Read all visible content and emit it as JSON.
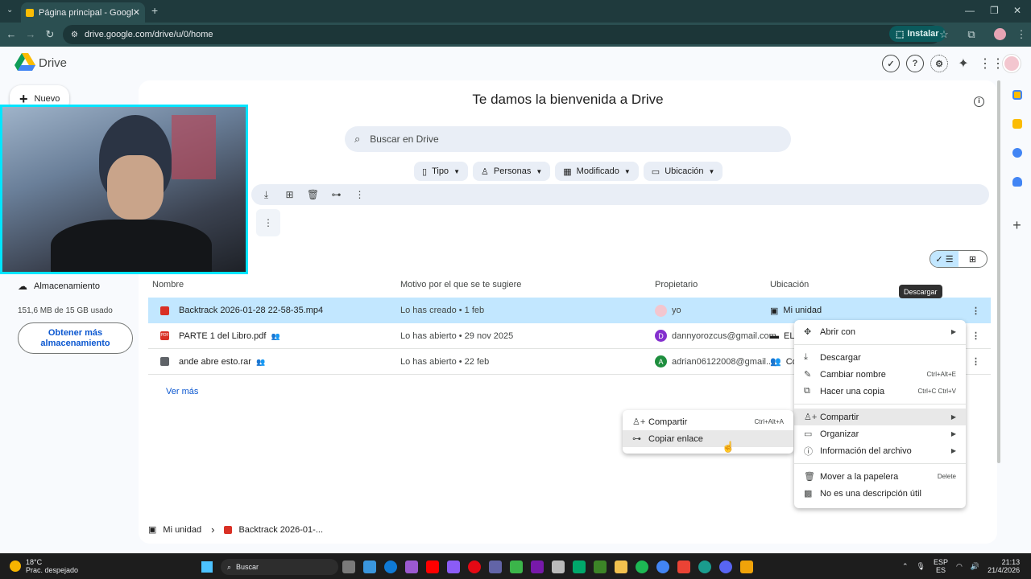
{
  "browser": {
    "tab_title": "Página principal - Google Drive",
    "url": "drive.google.com/drive/u/0/home",
    "install_label": "Instalar"
  },
  "app": {
    "brand": "Drive",
    "new_label": "Nuevo"
  },
  "sidebar": {
    "storage_label": "Almacenamiento",
    "storage_used": "151,6 MB de 15 GB usado",
    "get_more": "Obtener más almacenamiento"
  },
  "main": {
    "welcome": "Te damos la bienvenida a Drive",
    "search_placeholder": "Buscar en Drive",
    "filters": [
      "Tipo",
      "Personas",
      "Modificado",
      "Ubicación"
    ],
    "columns": [
      "Nombre",
      "Motivo por el que se te sugiere",
      "Propietario",
      "Ubicación"
    ],
    "rows": [
      {
        "name": "Backtrack 2026-01-28 22-58-35.mp4",
        "reason": "Lo has creado • 1 feb",
        "owner": "yo",
        "location": "Mi unidad",
        "icon": "video-icon",
        "icon_color": "#d93025"
      },
      {
        "name": "PARTE 1 del Libro.pdf",
        "reason": "Lo has abierto • 29 nov 2025",
        "owner": "dannyorozcus@gmail.com",
        "owner_initial": "D",
        "owner_color": "#8430ce",
        "location": "EL",
        "icon": "pdf-icon",
        "icon_color": "#d93025"
      },
      {
        "name": "ande abre esto.rar",
        "reason": "Lo has abierto • 22 feb",
        "owner": "adrian06122008@gmail....",
        "owner_initial": "A",
        "owner_color": "#1e8e3e",
        "location": "Co",
        "icon": "archive-icon",
        "icon_color": "#5f6368"
      }
    ],
    "see_more": "Ver más",
    "tooltip": "Descargar"
  },
  "context_menu": {
    "open_with": "Abrir con",
    "download": "Descargar",
    "rename": "Cambiar nombre",
    "rename_shortcut": "Ctrl+Alt+E",
    "copy": "Hacer una copia",
    "copy_shortcut": "Ctrl+C Ctrl+V",
    "share": "Compartir",
    "organize": "Organizar",
    "info": "Información del archivo",
    "trash": "Mover a la papelera",
    "trash_shortcut": "Delete",
    "not_useful": "No es una descripción útil"
  },
  "submenu": {
    "share": "Compartir",
    "share_shortcut": "Ctrl+Alt+A",
    "copy_link": "Copiar enlace"
  },
  "breadcrumb": {
    "root": "Mi unidad",
    "file": "Backtrack 2026-01-..."
  },
  "taskbar": {
    "temperature": "18°C",
    "weather": "Prac. despejado",
    "search": "Buscar",
    "lang1": "ESP",
    "lang2": "ES",
    "time": "21:13",
    "date": "21/4/2026"
  }
}
